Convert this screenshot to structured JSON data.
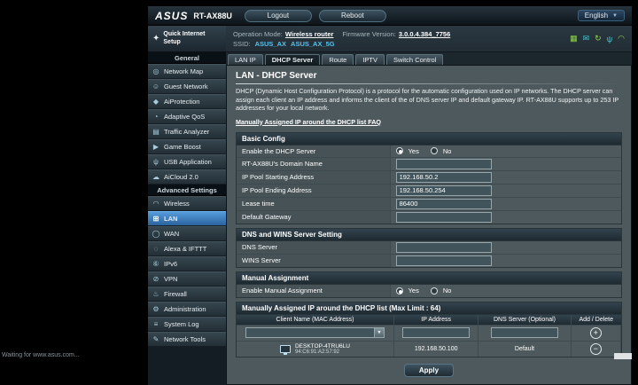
{
  "header": {
    "brand": "ASUS",
    "model": "RT-AX88U",
    "logout": "Logout",
    "reboot": "Reboot",
    "language": "English"
  },
  "infobar": {
    "operation_mode_label": "Operation Mode:",
    "operation_mode_value": "Wireless router",
    "firmware_label": "Firmware Version:",
    "firmware_value": "3.0.0.4.384_7756",
    "ssid_label": "SSID:",
    "ssid_2g": "ASUS_AX",
    "ssid_5g": "ASUS_AX_5G"
  },
  "sidebar": {
    "quick_setup": "Quick Internet Setup",
    "general_title": "General",
    "general_items": [
      "Network Map",
      "Guest Network",
      "AiProtection",
      "Adaptive QoS",
      "Traffic Analyzer",
      "Game Boost",
      "USB Application",
      "AiCloud 2.0"
    ],
    "advanced_title": "Advanced Settings",
    "advanced_items": [
      "Wireless",
      "LAN",
      "WAN",
      "Alexa & IFTTT",
      "IPv6",
      "VPN",
      "Firewall",
      "Administration",
      "System Log",
      "Network Tools"
    ],
    "active_item": "LAN"
  },
  "tabs": {
    "items": [
      "LAN IP",
      "DHCP Server",
      "Route",
      "IPTV",
      "Switch Control"
    ],
    "active": "DHCP Server"
  },
  "page": {
    "title": "LAN - DHCP Server",
    "description": "DHCP (Dynamic Host Configuration Protocol) is a protocol for the automatic configuration used on IP networks. The DHCP server can assign each client an IP address and informs the client of the of DNS server IP and default gateway IP. RT-AX88U supports up to 253 IP addresses for your local network.",
    "faq_link": "Manually Assigned IP around the DHCP list FAQ",
    "apply": "Apply"
  },
  "basic_config": {
    "title": "Basic Config",
    "enable_dhcp": "Enable the DHCP Server",
    "yes": "Yes",
    "no": "No",
    "domain_name": "RT-AX88U's Domain Name",
    "domain_value": "",
    "pool_start": "IP Pool Starting Address",
    "pool_start_value": "192.168.50.2",
    "pool_end": "IP Pool Ending Address",
    "pool_end_value": "192.168.50.254",
    "lease": "Lease time",
    "lease_value": "86400",
    "gateway": "Default Gateway",
    "gateway_value": ""
  },
  "dns_wins": {
    "title": "DNS and WINS Server Setting",
    "dns": "DNS Server",
    "dns_value": "",
    "wins": "WINS Server",
    "wins_value": ""
  },
  "manual": {
    "title": "Manual Assignment",
    "enable": "Enable Manual Assignment",
    "yes": "Yes",
    "no": "No"
  },
  "assign_table": {
    "title": "Manually Assigned IP around the DHCP list (Max Limit : 64)",
    "col_name": "Client Name (MAC Address)",
    "col_ip": "IP Address",
    "col_dns": "DNS Server (Optional)",
    "col_add": "Add / Delete",
    "rows": [
      {
        "name": "DESKTOP-4TRU6LU",
        "mac": "94:C6:91:A2:57:92",
        "ip": "192.168.50.100",
        "dns": "Default"
      }
    ]
  },
  "status_bar": {
    "text": "Waiting for www.asus.com..."
  },
  "icons": {
    "quick-setup": "✦",
    "network-map": "◎",
    "guest-network": "☺",
    "aiprotection": "◆",
    "adaptive-qos": "◔",
    "traffic-analyzer": "▤",
    "game-boost": "▶",
    "usb-application": "ψ",
    "aicloud": "☁",
    "wireless": "◠",
    "lan": "⊞",
    "wan": "◯",
    "alexa-ifttt": "◌",
    "ipv6": "⑥",
    "vpn": "⊘",
    "firewall": "♨",
    "administration": "⚙",
    "system-log": "≡",
    "network-tools": "✎",
    "app": "▦",
    "mail": "✉",
    "refresh": "↻",
    "usb": "ψ",
    "wifi": "◠",
    "chevron-down": "▼",
    "add": "+",
    "delete": "−"
  }
}
